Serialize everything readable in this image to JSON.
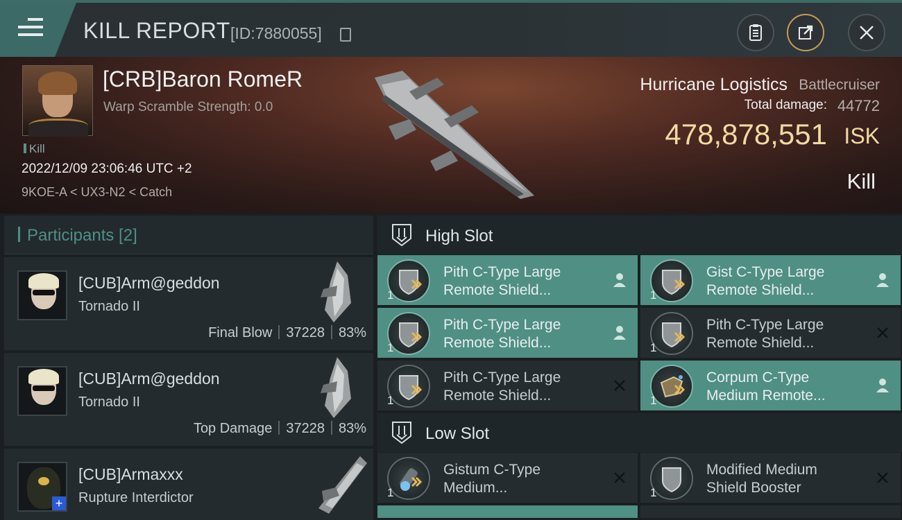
{
  "header": {
    "title": "KILL REPORT",
    "report_id": "[ID:7880055]"
  },
  "victim": {
    "name": "[CRB]Baron RomeR",
    "scramble": "Warp Scramble Strength: 0.0",
    "tag": "Kill",
    "datetime": "2022/12/09 23:06:46 UTC +2",
    "location": "9KOE-A < UX3-N2 < Catch",
    "ship_name": "Hurricane Logistics",
    "ship_class": "Battlecruiser",
    "damage_label": "Total damage:",
    "damage_value": "44772",
    "isk_value": "478,878,551",
    "isk_unit": "ISK",
    "result": "Kill"
  },
  "participants": {
    "label": "Participants [2]",
    "rows": [
      {
        "name": "[CUB]Arm@geddon",
        "ship": "Tornado II",
        "role": "Final Blow",
        "damage": "37228",
        "percent": "83%"
      },
      {
        "name": "[CUB]Arm@geddon",
        "ship": "Tornado II",
        "role": "Top Damage",
        "damage": "37228",
        "percent": "83%"
      },
      {
        "name": "[CUB]Armaxxx",
        "ship": "Rupture Interdictor"
      }
    ]
  },
  "high_slot": {
    "title": "High Slot",
    "modules": [
      {
        "qty": "1",
        "line1": "Pith C-Type Large",
        "line2": "Remote Shield...",
        "status": "fitted"
      },
      {
        "qty": "1",
        "line1": "Gist C-Type Large",
        "line2": "Remote Shield...",
        "status": "fitted"
      },
      {
        "qty": "1",
        "line1": "Pith C-Type Large",
        "line2": "Remote Shield...",
        "status": "fitted"
      },
      {
        "qty": "1",
        "line1": "Pith C-Type Large",
        "line2": "Remote Shield...",
        "status": "destroyed"
      },
      {
        "qty": "1",
        "line1": "Pith C-Type Large",
        "line2": "Remote Shield...",
        "status": "destroyed"
      },
      {
        "qty": "1",
        "line1": "Corpum C-Type",
        "line2": "Medium Remote...",
        "status": "fitted"
      }
    ]
  },
  "low_slot": {
    "title": "Low Slot",
    "modules": [
      {
        "qty": "1",
        "line1": "Gistum C-Type",
        "line2": "Medium...",
        "status": "destroyed"
      },
      {
        "qty": "1",
        "line1": "Modified Medium",
        "line2": "Shield Booster",
        "status": "destroyed"
      }
    ]
  },
  "colors": {
    "accent_teal": "#4f8f84",
    "isk_gold": "#f2d9a2",
    "banner_red": "#4f2a22"
  }
}
